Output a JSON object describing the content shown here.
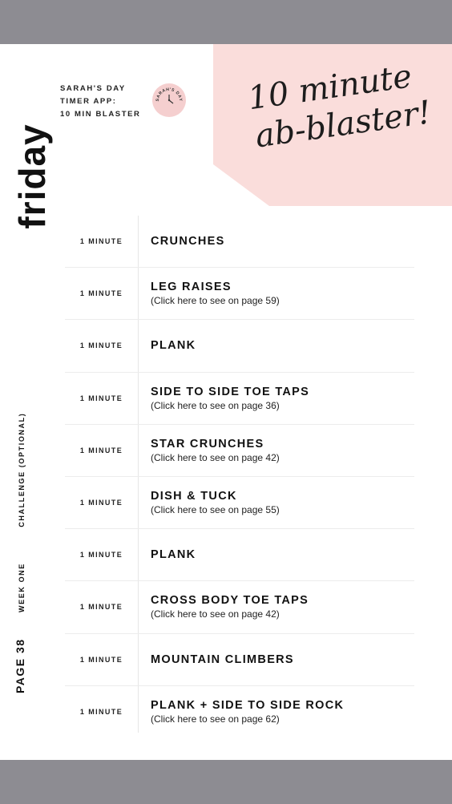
{
  "day": "friday",
  "header": {
    "label_lines": [
      "SARAH'S DAY",
      "TIMER APP:",
      "10 MIN BLASTER"
    ],
    "logo_text": "SARAH'S DAY"
  },
  "title": {
    "line1": "10 minute",
    "line2": "ab-blaster!"
  },
  "side": {
    "page": "PAGE 38",
    "week": "WEEK ONE",
    "section": "CHALLENGE (OPTIONAL)"
  },
  "exercises": [
    {
      "duration": "1 MINUTE",
      "name": "CRUNCHES",
      "link": ""
    },
    {
      "duration": "1 MINUTE",
      "name": "LEG RAISES",
      "link": "(Click here to see on page 59)"
    },
    {
      "duration": "1 MINUTE",
      "name": "PLANK",
      "link": ""
    },
    {
      "duration": "1 MINUTE",
      "name": "SIDE TO SIDE TOE TAPS",
      "link": "(Click here to see on page 36)"
    },
    {
      "duration": "1 MINUTE",
      "name": "STAR CRUNCHES",
      "link": "(Click here to see on page 42)"
    },
    {
      "duration": "1 MINUTE",
      "name": "DISH & TUCK",
      "link": "(Click here to see on page 55)"
    },
    {
      "duration": "1 MINUTE",
      "name": "PLANK",
      "link": ""
    },
    {
      "duration": "1 MINUTE",
      "name": "CROSS BODY TOE TAPS",
      "link": "(Click here to see on page 42)"
    },
    {
      "duration": "1 MINUTE",
      "name": "MOUNTAIN CLIMBERS",
      "link": ""
    },
    {
      "duration": "1 MINUTE",
      "name": "PLANK + SIDE TO SIDE ROCK",
      "link": "(Click here to see on page 62)"
    }
  ],
  "colors": {
    "pink_panel": "#fadddb",
    "logo_bg": "#f5cfcf",
    "frame_gray": "#8d8c92"
  }
}
